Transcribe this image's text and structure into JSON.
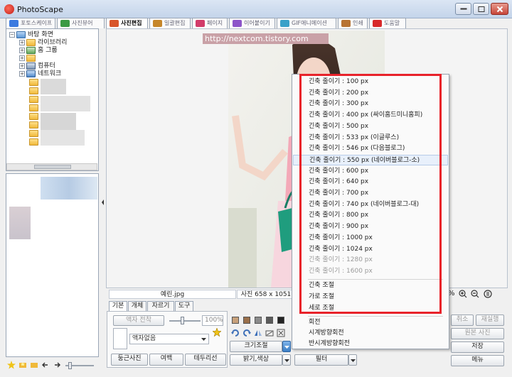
{
  "window": {
    "title": "PhotoScape"
  },
  "tabs": [
    {
      "label": "포토스케이프",
      "color": "#3d7be0"
    },
    {
      "label": "사진뷰어",
      "color": "#3b9a44"
    },
    {
      "label": "사진편집",
      "color": "#d9562b"
    },
    {
      "label": "일괄편집",
      "color": "#c6862a"
    },
    {
      "label": "페이지",
      "color": "#d23c6a"
    },
    {
      "label": "이어붙이기",
      "color": "#8d55c9"
    },
    {
      "label": "GIF애니메이션",
      "color": "#3aa1c9"
    },
    {
      "label": "인쇄",
      "color": "#b87333"
    },
    {
      "label": "도움말",
      "color": "#d8292a"
    }
  ],
  "tree": [
    {
      "label": "바탕 화면",
      "indent": 0
    },
    {
      "label": "라이브러리",
      "indent": 1
    },
    {
      "label": "홈 그룹",
      "indent": 1
    },
    {
      "label": "",
      "indent": 1
    },
    {
      "label": "컴퓨터",
      "indent": 1
    },
    {
      "label": "네트워크",
      "indent": 1
    }
  ],
  "watermark": "http://nextcom.tistory.com",
  "file_info": {
    "name": "예린.jpg",
    "size": "사진 658 x 1051"
  },
  "bottom_tabs": [
    "기본",
    "개체",
    "자르기",
    "도구"
  ],
  "left_controls": {
    "frame_apply": "액자 전착",
    "zoom_value": "100%",
    "frame_select": "액자없음",
    "round_button": "둥근사진",
    "margin_button": "여백",
    "border_button": "테두리선"
  },
  "mid_controls": {
    "resize_button": "크기조절",
    "bright_button": "밝기,색상",
    "filter_button": "필터"
  },
  "right_buttons": {
    "cancel": "취소",
    "redo": "재실행",
    "original": "원본 사진",
    "save": "저장",
    "menu": "메뉴"
  },
  "zoom_label": "%",
  "resize_menu": {
    "items": [
      {
        "label": "긴축 줄이기 : 100 px",
        "enabled": true
      },
      {
        "label": "긴축 줄이기 : 200 px",
        "enabled": true
      },
      {
        "label": "긴축 줄이기 : 300 px",
        "enabled": true
      },
      {
        "label": "긴축 줄이기 : 400 px (싸이홈드미니홈피)",
        "enabled": true
      },
      {
        "label": "긴축 줄이기 : 500 px",
        "enabled": true
      },
      {
        "label": "긴축 줄이기 : 533 px (이글루스)",
        "enabled": true
      },
      {
        "label": "긴축 줄이기 : 546 px (다음블로그)",
        "enabled": true
      },
      {
        "label": "긴축 줄이기 : 550 px (네이버블로그-소)",
        "enabled": true
      },
      {
        "label": "긴축 줄이기 : 600 px",
        "enabled": true
      },
      {
        "label": "긴축 줄이기 : 640 px",
        "enabled": true
      },
      {
        "label": "긴축 줄이기 : 700 px",
        "enabled": true
      },
      {
        "label": "긴축 줄이기 : 740 px (네이버블로그-대)",
        "enabled": true
      },
      {
        "label": "긴축 줄이기 : 800 px",
        "enabled": true
      },
      {
        "label": "긴축 줄이기 : 900 px",
        "enabled": true
      },
      {
        "label": "긴축 줄이기 : 1000 px",
        "enabled": true
      },
      {
        "label": "긴축 줄이기 : 1024 px",
        "enabled": true
      },
      {
        "label": "긴축 줄이기 : 1280 px",
        "enabled": false
      },
      {
        "label": "긴축 줄이기 : 1600 px",
        "enabled": false
      }
    ],
    "adjust_items": [
      "긴축 조절",
      "가로 조절",
      "세로 조절"
    ],
    "rotate_items": [
      "회전",
      "시계방향회전",
      "반시계방향회전"
    ]
  },
  "colors": {
    "highlight_box": "#e8222a",
    "menu_hover": "#e8f0fb"
  }
}
